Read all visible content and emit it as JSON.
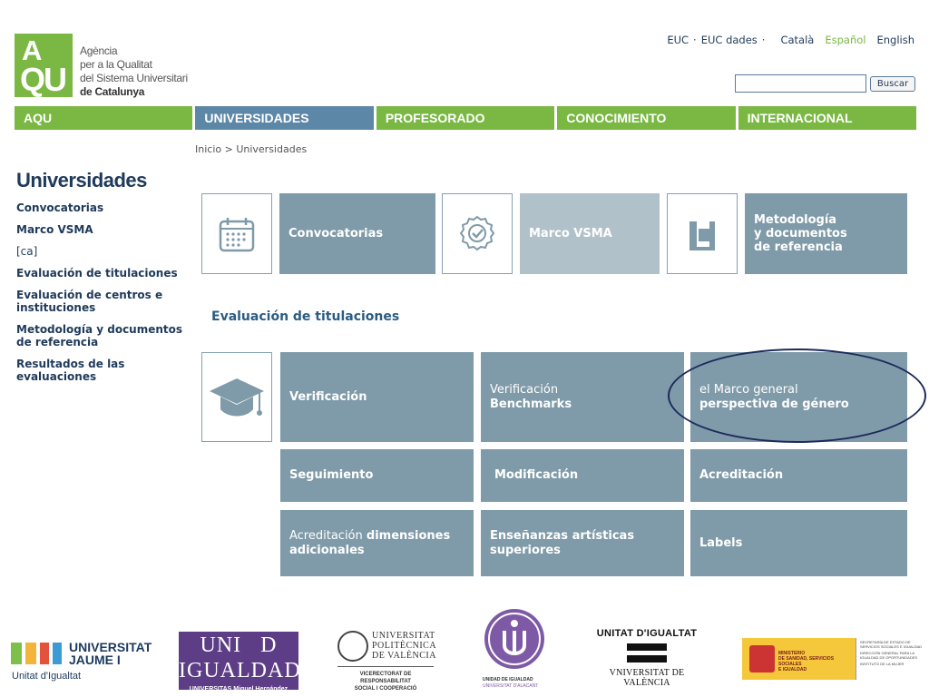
{
  "logo": {
    "mark_line1": "A",
    "mark_line2": "QU",
    "name_lines": [
      "Agència",
      "per a la Qualitat",
      "del Sistema Universitari",
      "de Catalunya"
    ]
  },
  "toplinks": {
    "euc": "EUC",
    "euc_dades": "EUC dades",
    "langs": [
      "Català",
      "Español",
      "English"
    ],
    "active_lang": "Español"
  },
  "search": {
    "value": "",
    "button_label": "Buscar"
  },
  "nav": [
    "AQU",
    "UNIVERSIDADES",
    "PROFESORADO",
    "CONOCIMIENTO",
    "INTERNACIONAL"
  ],
  "breadcrumb": "Inicio > Universidades",
  "sidebar": {
    "title": "Universidades",
    "items": [
      "Convocatorias",
      "Marco VSMA",
      "[ca]",
      "Evaluación de titulaciones",
      "Evaluación de centros e instituciones",
      "Metodología y documentos de referencia",
      "Resultados de las evaluaciones"
    ]
  },
  "top_tiles": {
    "convocatorias": "Convocatorias",
    "marco_vsma": "Marco VSMA",
    "metodologia": [
      "Metodología",
      "y documentos",
      "de referencia"
    ]
  },
  "section_title": "Evaluación de titulaciones",
  "eval_tiles": {
    "verificacion": "Verificación",
    "verif_bench_line1": "Verificación",
    "verif_bench_line2": "Benchmarks",
    "marco_genero_line1": "el Marco general",
    "marco_genero_line2": "perspectiva de género",
    "seguimiento": "Seguimiento",
    "modificacion": "Modificación",
    "acreditacion": "Acreditación",
    "acred_dim_normal": "Acreditación ",
    "acred_dim_bold1": "dimensiones",
    "acred_dim_bold2": "adicionales",
    "ensenanzas": [
      "Enseñanzas artísticas",
      "superiores"
    ],
    "labels": "Labels"
  },
  "footer": {
    "uji_name": [
      "UNIVERSITAT",
      "JAUME I"
    ],
    "uji_sub": "Unitat d'Igualtat",
    "umh_top": "UNI",
    "umh_top_right": "D",
    "umh_bottom": "IGUALDAD",
    "umh_small": "UNIVERSITAS Miguel Hernández",
    "upv_name": [
      "UNIVERSITAT",
      "POLITÈCNICA",
      "DE VALÈNCIA"
    ],
    "upv_vice": [
      "VICERECTORAT DE RESPONSABILITAT",
      "SOCIAL I COOPERACIÓ"
    ],
    "ua_label1": "UNIDAD DE IGUALDAD",
    "ua_label2": "UNIVERSITAT D'ALACANT",
    "uv_title": "UNITAT D'IGUALTAT",
    "uv_name": "VNIVERSITAT DE VALÈNCIA",
    "ministerio": [
      "MINISTERIO",
      "DE SANIDAD, SERVICIOS SOCIALES",
      "E IGUALDAD"
    ],
    "ministerio_right": [
      "SECRETARÍA DE ESTADO DE SERVICIOS SOCIALES E IGUALDAD",
      "DIRECCIÓN GENERAL PARA LA IGUALDAD DE OPORTUNIDADES",
      "INSTITUTO DE LA MUJER"
    ]
  },
  "colors": {
    "green": "#7ab843",
    "nav_active": "#5d87a6",
    "tile": "#7f9aa8",
    "tile_light": "#b1c1ca",
    "dark_blue": "#1f3a5a",
    "annotation": "#1c2a5c"
  }
}
